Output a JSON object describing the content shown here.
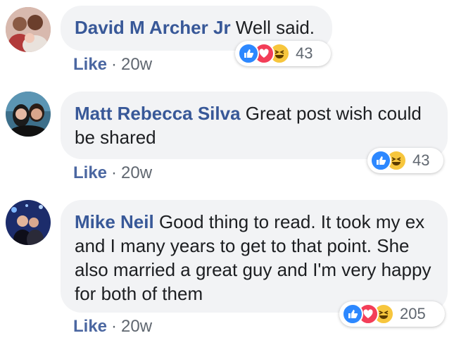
{
  "comments": [
    {
      "author": "David M Archer Jr",
      "text": "Well said.",
      "like_label": "Like",
      "separator": "·",
      "time": "20w",
      "reactions": [
        "like-icon",
        "love-icon",
        "haha-icon"
      ],
      "reaction_count": "43"
    },
    {
      "author": "Matt Rebecca Silva",
      "text": "Great post wish could be shared",
      "like_label": "Like",
      "separator": "·",
      "time": "20w",
      "reactions": [
        "like-icon",
        "haha-icon"
      ],
      "reaction_count": "43"
    },
    {
      "author": "Mike Neil",
      "text": "Good thing to read. It took my ex and I many years to get to that point. She also married a great guy and I'm very happy for both of them",
      "like_label": "Like",
      "separator": "·",
      "time": "20w",
      "reactions": [
        "like-icon",
        "love-icon",
        "haha-icon"
      ],
      "reaction_count": "205"
    }
  ],
  "colors": {
    "author": "#385898",
    "bubble": "#f2f3f5",
    "like": "#2d88ff",
    "love": "#f33e58",
    "haha": "#f7c63d"
  }
}
